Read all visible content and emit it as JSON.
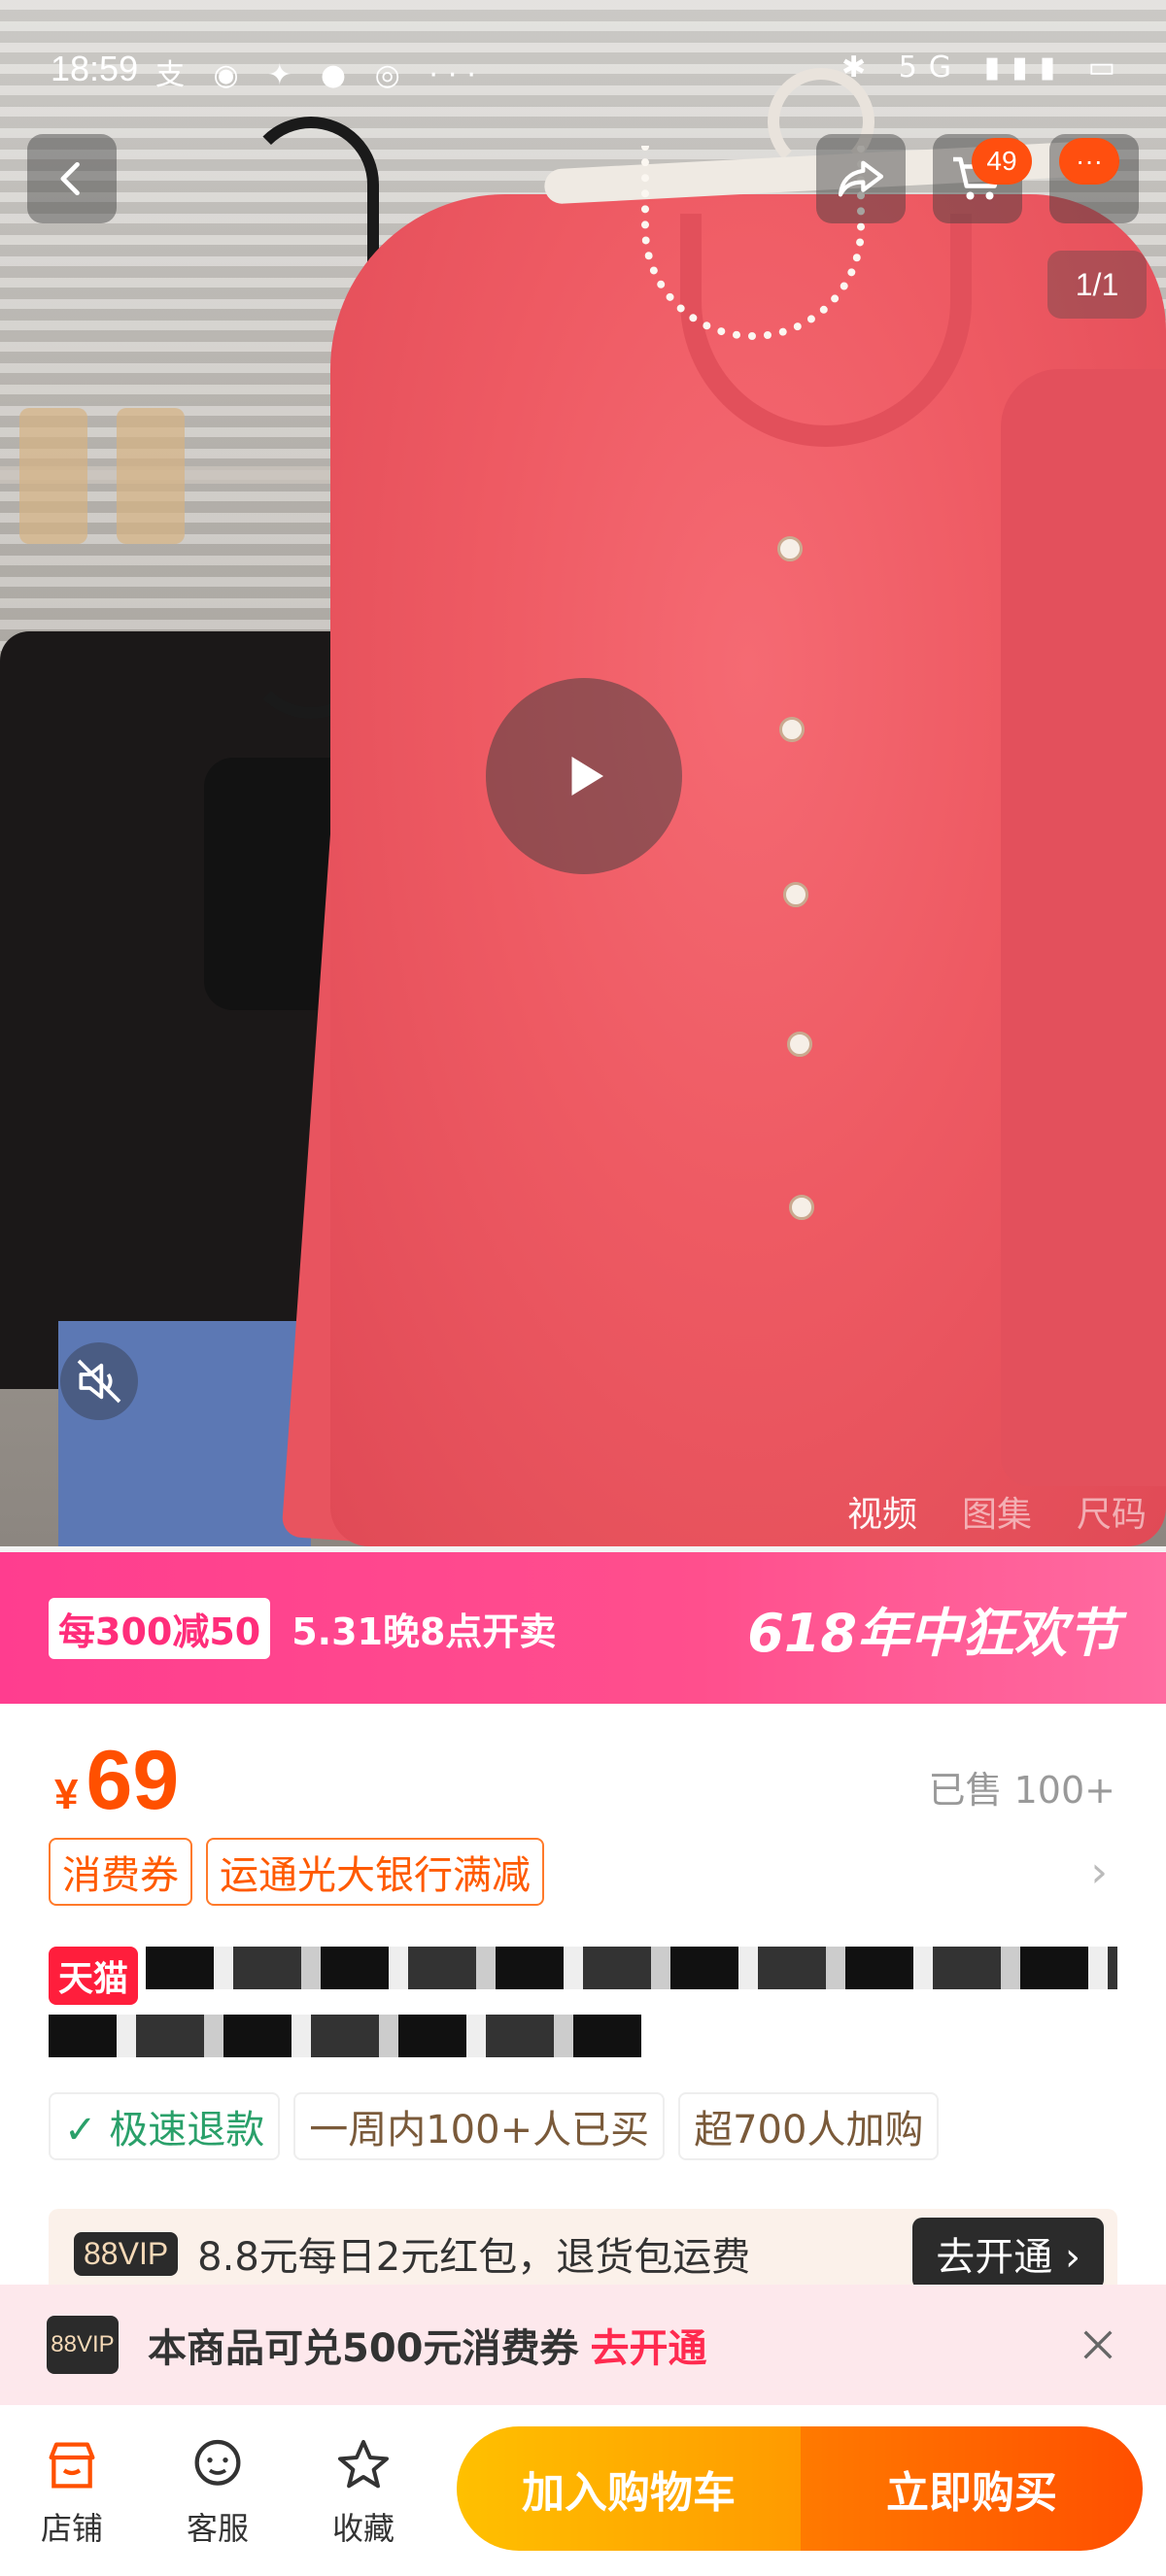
{
  "status_bar": {
    "time": "18:59",
    "left_icons": "支 ◉ ✦ ● ◎ ···",
    "right_icons": "✱ 5G ▮▮▮ ▭"
  },
  "top_bar": {
    "cart_badge": "49",
    "more_badge": "···"
  },
  "media": {
    "counter": "1/1",
    "tabs": [
      "视频",
      "图集",
      "尺码"
    ],
    "active_tab": 0
  },
  "promo": {
    "tag": "每300减50",
    "time": "5.31晚8点开卖",
    "festival": "618年中狂欢节"
  },
  "product": {
    "currency": "¥",
    "price": "69",
    "sold": "已售 100+",
    "coupons": [
      "消费券",
      "运通光大银行满减"
    ],
    "store_badge": "天猫",
    "tags": [
      "极速退款",
      "一周内100+人已买",
      "超700人加购"
    ]
  },
  "vip": {
    "logo": "88VIP",
    "text": "8.8元每日2元红包，退货包运费",
    "button": "去开通 ›"
  },
  "notice": {
    "logo": "88VIP",
    "text": "本商品可兑500元消费券",
    "link": "去开通"
  },
  "bottom_nav": [
    {
      "label": "店铺",
      "icon": "store-icon"
    },
    {
      "label": "客服",
      "icon": "chat-icon"
    },
    {
      "label": "收藏",
      "icon": "star-icon"
    }
  ],
  "cta": {
    "add_to_cart": "加入购物车",
    "buy_now": "立即购买"
  },
  "colors": {
    "accent": "#ff5000",
    "promo": "#ff3d8f",
    "tmall": "#ff1e3c"
  }
}
